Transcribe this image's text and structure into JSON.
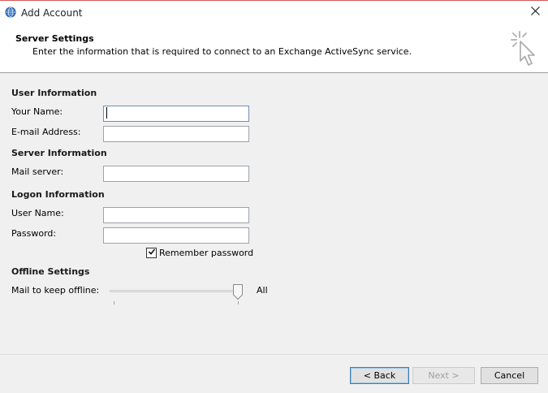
{
  "window": {
    "title": "Add Account"
  },
  "header": {
    "title": "Server Settings",
    "subtitle": "Enter the information that is required to connect to an Exchange ActiveSync service."
  },
  "user_info": {
    "heading": "User Information",
    "your_name_label": "Your Name:",
    "your_name_value": "",
    "email_label": "E-mail Address:",
    "email_value": ""
  },
  "server_info": {
    "heading": "Server Information",
    "mail_server_label": "Mail server:",
    "mail_server_value": ""
  },
  "logon_info": {
    "heading": "Logon Information",
    "user_name_label": "User Name:",
    "user_name_value": "",
    "password_label": "Password:",
    "password_value": "",
    "remember_label": "Remember password",
    "remember_checked": true
  },
  "offline": {
    "heading": "Offline Settings",
    "mail_keep_label": "Mail to keep offline:",
    "slider_value_label": "All",
    "slider_position": 1.0
  },
  "buttons": {
    "back": "< Back",
    "next": "Next >",
    "cancel": "Cancel"
  },
  "icons": {
    "app": "outlook-globe-icon",
    "close": "close-icon",
    "header": "cursor-click-icon",
    "checkbox": "checkmark-icon"
  }
}
